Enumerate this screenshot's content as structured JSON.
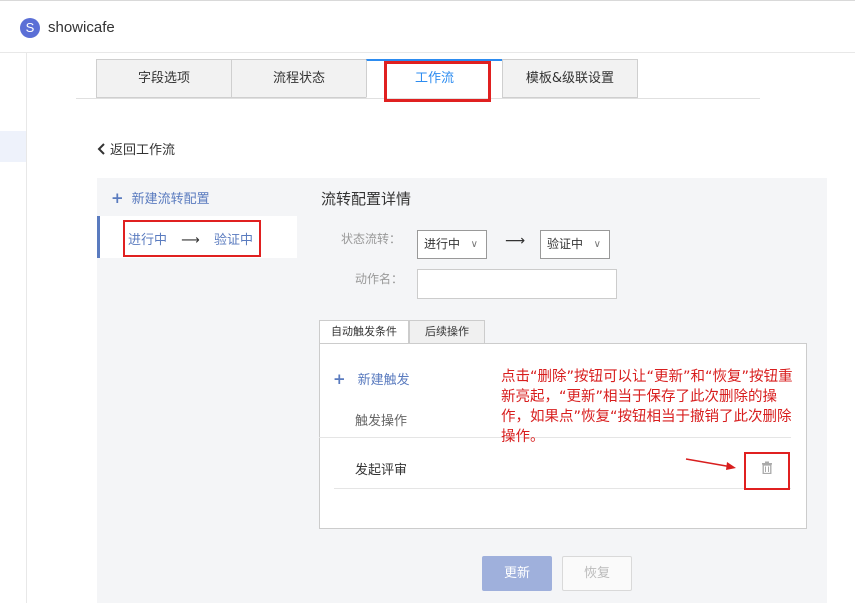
{
  "app": {
    "logo_letter": "S",
    "title": "showicafe"
  },
  "tabs": [
    {
      "label": "字段选项"
    },
    {
      "label": "流程状态"
    },
    {
      "label": "工作流",
      "active": true
    },
    {
      "label": "模板&级联设置"
    }
  ],
  "back_link": "返回工作流",
  "left_panel": {
    "new_config": "新建流转配置",
    "selected_item": {
      "from": "进行中",
      "to": "验证中"
    }
  },
  "detail": {
    "title": "流转配置详情",
    "state_flow_label": "状态流转：",
    "from_state": "进行中",
    "to_state": "验证中",
    "action_name_label": "动作名：",
    "action_name_value": ""
  },
  "inner_tabs": [
    "自动触发条件",
    "后续操作"
  ],
  "triggers": {
    "new_trigger": "新建触发",
    "header": "触发操作",
    "rows": [
      {
        "label": "发起评审"
      }
    ]
  },
  "annotation": "点击“删除”按钮可以让“更新”和“恢复”按钮重新亮起，“更新”相当于保存了此次删除的操作，如果点”恢复“按钮相当于撤销了此次删除操作。",
  "buttons": {
    "update": "更新",
    "restore": "恢复"
  },
  "colors": {
    "accent": "#5a7bbf",
    "active_tab": "#2d8cf0",
    "highlight": "#e02020",
    "annotation": "#d81e1e"
  },
  "icons": [
    "app-logo-icon",
    "chevron-left-icon",
    "plus-icon",
    "arrow-right-icon",
    "chevron-down-icon",
    "trash-icon"
  ]
}
